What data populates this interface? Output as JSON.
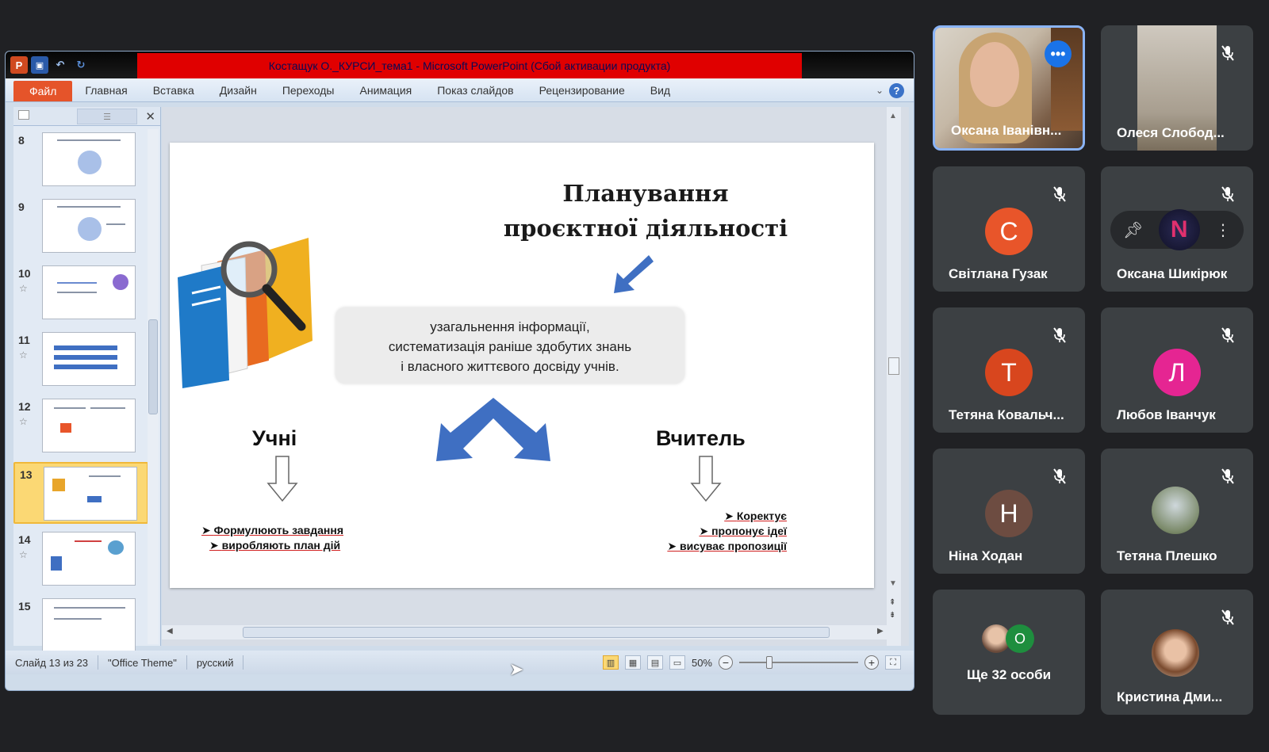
{
  "window": {
    "title": "Костащук О._КУРСИ_тема1 - Microsoft PowerPoint (Сбой активации продукта)"
  },
  "ribbon": {
    "tabs": [
      "Файл",
      "Главная",
      "Вставка",
      "Дизайн",
      "Переходы",
      "Анимация",
      "Показ слайдов",
      "Рецензирование",
      "Вид"
    ]
  },
  "slides_pane": {
    "slide_numbers": [
      "8",
      "9",
      "10",
      "11",
      "12",
      "13",
      "14",
      "15"
    ],
    "active": "13"
  },
  "slide": {
    "title_line1": "Планування",
    "title_line2": "проєктної діяльності",
    "box_line1": "узагальнення інформації,",
    "box_line2": "систематизація раніше здобутих знань",
    "box_line3": "і власного життєвого досвіду учнів.",
    "pupils_label": "Учні",
    "pupils_bullets": [
      "Формулюють завдання",
      "виробляють план дій"
    ],
    "teacher_label": "Вчитель",
    "teacher_bullets": [
      "Коректує",
      "пропонує ідеї",
      "висуває пропозиції"
    ]
  },
  "statusbar": {
    "slide_info": "Слайд 13 из 23",
    "theme": "\"Office Theme\"",
    "language": "русский",
    "zoom": "50%",
    "zoom_fraction": 0.25
  },
  "participants": [
    {
      "name": "Оксана Іванівн...",
      "initial": "",
      "color": ""
    },
    {
      "name": "Олеся Слобод...",
      "initial": "",
      "color": ""
    },
    {
      "name": "Світлана Гузак",
      "initial": "С",
      "color": "#e8552a"
    },
    {
      "name": "Оксана Шикірюк",
      "initial": "N",
      "color": "#e0306e"
    },
    {
      "name": "Тетяна Ковальч...",
      "initial": "Т",
      "color": "#d8461e"
    },
    {
      "name": "Любов Іванчук",
      "initial": "Л",
      "color": "#e52592"
    },
    {
      "name": "Ніна Ходан",
      "initial": "Н",
      "color": "#6d4c41"
    },
    {
      "name": "Тетяна Плешко",
      "initial": "",
      "color": ""
    },
    {
      "name": "Ще 32 особи",
      "initial": "О",
      "color": "#1e8e3e"
    },
    {
      "name": "Кристина Дми...",
      "initial": "",
      "color": ""
    }
  ],
  "colors": {
    "meet_background": "#202124",
    "tile": "#3c4043",
    "accent_blue": "#1a73e8",
    "slide_arrow_blue": "#3f6fc2",
    "title_bar_red": "#e00000"
  }
}
